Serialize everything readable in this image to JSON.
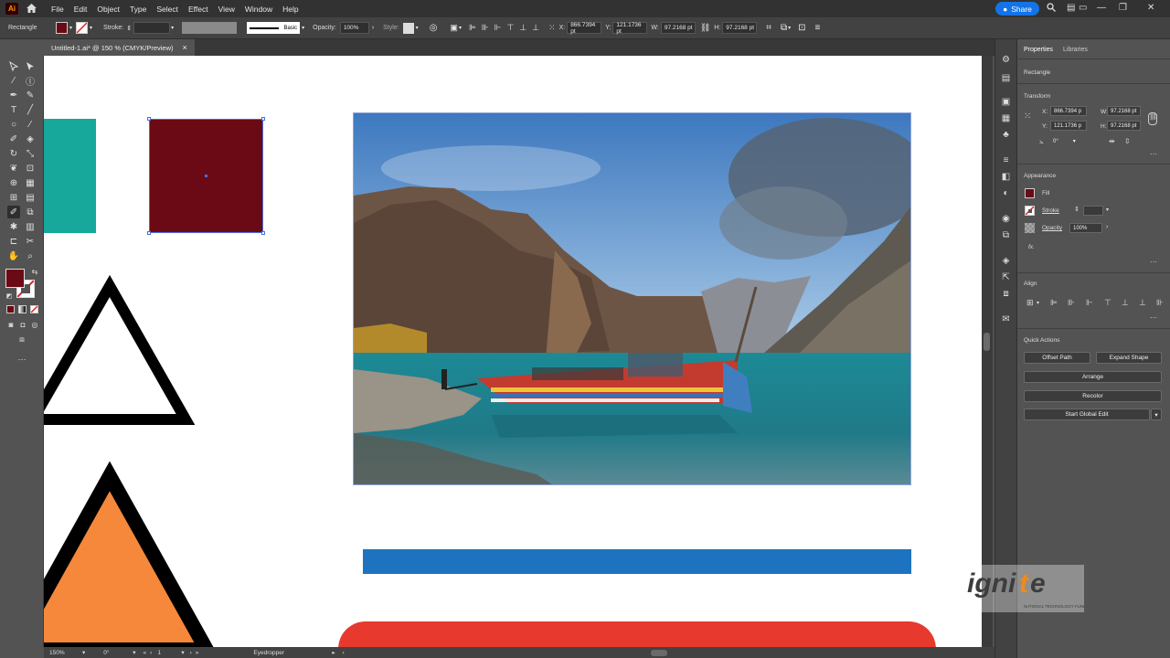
{
  "app": {
    "logo": "Ai"
  },
  "menu": [
    "File",
    "Edit",
    "Object",
    "Type",
    "Select",
    "Effect",
    "View",
    "Window",
    "Help"
  ],
  "share_label": "Share",
  "control_bar": {
    "object_type": "Rectangle",
    "stroke_label": "Stroke:",
    "stroke_profile": "Basic",
    "opacity_label": "Opacity:",
    "opacity_value": "100%",
    "style_label": "Style:",
    "x_label": "X:",
    "x_value": "866.7394 pt",
    "y_label": "Y:",
    "y_value": "121.1736 pt",
    "w_label": "W:",
    "w_value": "97.2168 pt",
    "h_label": "H:",
    "h_value": "97.2168 pt"
  },
  "document_tab": {
    "title": "Untitled-1.ai* @ 150 % (CMYK/Preview)",
    "close": "×"
  },
  "status_bar": {
    "zoom": "150%",
    "rotation": "0°",
    "artboard": "1",
    "tool": "Eyedropper"
  },
  "properties": {
    "tabs": [
      "Properties",
      "Libraries"
    ],
    "selection": "Rectangle",
    "transform_title": "Transform",
    "x_label": "X:",
    "x": "866.7394 p",
    "y_label": "Y:",
    "y": "121.1736 p",
    "w_label": "W:",
    "w": "97.2168 pt",
    "h_label": "H:",
    "h": "97.2168 pt",
    "angle": "0°",
    "appearance_title": "Appearance",
    "fill_label": "Fill",
    "stroke_label": "Stroke",
    "opacity_label": "Opacity",
    "opacity_value": "100%",
    "fx": "fx.",
    "align_title": "Align",
    "quick_actions_title": "Quick Actions",
    "quick_actions": [
      "Offset Path",
      "Expand Shape",
      "Arrange",
      "Recolor",
      "Start Global Edit"
    ]
  },
  "colors": {
    "fill": "#6b0a14",
    "teal": "#17a89b",
    "blue_bar": "#1d73bf",
    "red_shape": "#e8392f",
    "orange": "#f5883a",
    "accent": "#1473e6"
  },
  "watermark": {
    "brand": "ignite",
    "tagline": "NATIONAL TECHNOLOGY FUND"
  }
}
